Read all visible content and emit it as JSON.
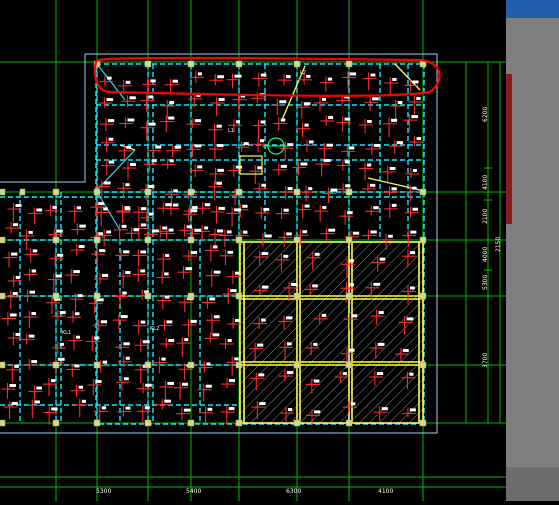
{
  "drawing": {
    "right_dimensions": [
      "6200",
      "4100",
      "2100",
      "2150",
      "4000",
      "5300",
      "3700"
    ],
    "bottom_dimensions": [
      "5300",
      "5400",
      "6300",
      "4100"
    ],
    "beam_labels": [
      "KL1",
      "KL2",
      "L1",
      "L2"
    ]
  },
  "colors": {
    "background": "#000000",
    "grid": "#00c000",
    "beam": "#00ffff",
    "column": "#ffff66",
    "rebar": "#ff2a2a",
    "text": "#ffffff",
    "markup": "#ff0000"
  },
  "side_panel": {
    "accent": "#1f5fae"
  }
}
